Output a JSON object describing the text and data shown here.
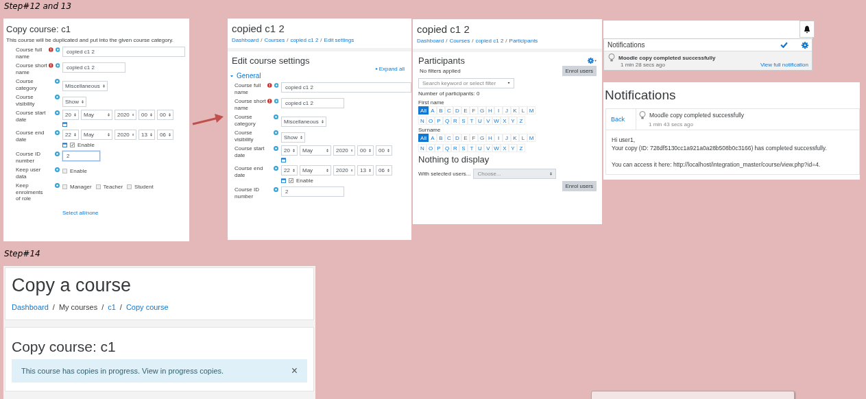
{
  "step_labels": [
    "Step#12 and 13",
    "Step#14"
  ],
  "copy_form": {
    "title": "Copy course: c1",
    "description": "This course will be duplicated and put into the given course category.",
    "fields": [
      {
        "label": "Course full name",
        "required": true,
        "help": true,
        "kind": "text",
        "value": "copied c1 2",
        "focused": false
      },
      {
        "label": "Course short name",
        "required": true,
        "help": true,
        "kind": "shorttext",
        "value": "copied c1 2",
        "focused": false
      },
      {
        "label": "Course category",
        "required": false,
        "help": true,
        "kind": "select",
        "value": "Miscellaneous"
      },
      {
        "label": "Course visibility",
        "required": false,
        "help": true,
        "kind": "select",
        "value": "Show"
      },
      {
        "label": "Course start date",
        "required": false,
        "help": true,
        "kind": "date",
        "parts": [
          "20",
          "May",
          "2020",
          "00",
          "00"
        ]
      },
      {
        "label": "Course end date",
        "required": false,
        "help": true,
        "kind": "date",
        "parts": [
          "22",
          "May",
          "2020",
          "13",
          "06"
        ],
        "enable": {
          "label": "Enable",
          "checked": true
        }
      },
      {
        "label": "Course ID number",
        "required": false,
        "help": true,
        "kind": "shorttext",
        "value": "2",
        "focused": true
      },
      {
        "label": "Keep user data",
        "required": false,
        "help": true,
        "kind": "checks",
        "options": [
          {
            "label": "Enable",
            "checked": false
          }
        ]
      },
      {
        "label": "Keep enrolments of role",
        "required": false,
        "help": true,
        "kind": "checks",
        "options": [
          {
            "label": "Manager",
            "checked": false
          },
          {
            "label": "Teacher",
            "checked": false
          },
          {
            "label": "Student",
            "checked": false
          }
        ]
      }
    ],
    "link": "Select all/none"
  },
  "edit_settings": {
    "course_title": "copied c1 2",
    "breadcrumbs": {
      "separator": "/",
      "items": [
        {
          "label": "Dashboard",
          "link": true
        },
        {
          "label": "Courses",
          "link": true
        },
        {
          "label": "copied c1 2",
          "link": true
        },
        {
          "label": "Edit settings",
          "link": true
        }
      ]
    },
    "heading": "Edit course settings",
    "expand_all": "Expand all",
    "section": {
      "label": "General",
      "expanded": true
    },
    "fields": [
      {
        "label": "Course full name",
        "required": true,
        "help": true,
        "kind": "text",
        "value": "copied c1 2",
        "focused": false
      },
      {
        "label": "Course short name",
        "required": true,
        "help": true,
        "kind": "shorttext",
        "value": "copied c1 2",
        "focused": false
      },
      {
        "label": "Course category",
        "required": false,
        "help": true,
        "kind": "select",
        "value": "Miscellaneous"
      },
      {
        "label": "Course visibility",
        "required": false,
        "help": true,
        "kind": "select",
        "value": "Show"
      },
      {
        "label": "Course start date",
        "required": false,
        "help": true,
        "kind": "date",
        "parts": [
          "20",
          "May",
          "2020",
          "00",
          "00"
        ]
      },
      {
        "label": "Course end date",
        "required": false,
        "help": true,
        "kind": "date",
        "parts": [
          "22",
          "May",
          "2020",
          "13",
          "06"
        ],
        "enable": {
          "label": "Enable",
          "checked": true
        }
      },
      {
        "label": "Course ID number",
        "required": false,
        "help": true,
        "kind": "shorttext",
        "value": "2",
        "focused": false
      }
    ]
  },
  "participants": {
    "course_title": "copied c1 2",
    "breadcrumbs": {
      "separator": "/",
      "items": [
        {
          "label": "Dashboard",
          "link": true
        },
        {
          "label": "Courses",
          "link": true
        },
        {
          "label": "copied c1 2",
          "link": true
        },
        {
          "label": "Participants",
          "link": true
        }
      ]
    },
    "heading": "Participants",
    "filters": "No filters applied",
    "enrol_button": "Enrol users",
    "search_placeholder": "Search keyword or select filter",
    "count": "Number of participants: 0",
    "initials": [
      {
        "label": "First name",
        "letters": [
          {
            "label": "All",
            "selected": true
          },
          {
            "label": "A",
            "selected": false
          },
          {
            "label": "B",
            "selected": false
          },
          {
            "label": "C",
            "selected": false
          },
          {
            "label": "D",
            "selected": false
          },
          {
            "label": "E",
            "selected": false
          },
          {
            "label": "F",
            "selected": false
          },
          {
            "label": "G",
            "selected": false
          },
          {
            "label": "H",
            "selected": false
          },
          {
            "label": "I",
            "selected": false
          },
          {
            "label": "J",
            "selected": false
          },
          {
            "label": "K",
            "selected": false
          },
          {
            "label": "L",
            "selected": false
          },
          {
            "label": "M",
            "selected": false
          },
          {
            "label": "N",
            "selected": false
          },
          {
            "label": "O",
            "selected": false
          },
          {
            "label": "P",
            "selected": false
          },
          {
            "label": "Q",
            "selected": false
          },
          {
            "label": "R",
            "selected": false
          },
          {
            "label": "S",
            "selected": false
          },
          {
            "label": "T",
            "selected": false
          },
          {
            "label": "U",
            "selected": false
          },
          {
            "label": "V",
            "selected": false
          },
          {
            "label": "W",
            "selected": false
          },
          {
            "label": "X",
            "selected": false
          },
          {
            "label": "Y",
            "selected": false
          },
          {
            "label": "Z",
            "selected": false
          }
        ]
      },
      {
        "label": "Surname",
        "letters": [
          {
            "label": "All",
            "selected": true
          },
          {
            "label": "A",
            "selected": false
          },
          {
            "label": "B",
            "selected": false
          },
          {
            "label": "C",
            "selected": false
          },
          {
            "label": "D",
            "selected": false
          },
          {
            "label": "E",
            "selected": false
          },
          {
            "label": "F",
            "selected": false
          },
          {
            "label": "G",
            "selected": false
          },
          {
            "label": "H",
            "selected": false
          },
          {
            "label": "I",
            "selected": false
          },
          {
            "label": "J",
            "selected": false
          },
          {
            "label": "K",
            "selected": false
          },
          {
            "label": "L",
            "selected": false
          },
          {
            "label": "M",
            "selected": false
          },
          {
            "label": "N",
            "selected": false
          },
          {
            "label": "O",
            "selected": false
          },
          {
            "label": "P",
            "selected": false
          },
          {
            "label": "Q",
            "selected": false
          },
          {
            "label": "R",
            "selected": false
          },
          {
            "label": "S",
            "selected": false
          },
          {
            "label": "T",
            "selected": false
          },
          {
            "label": "U",
            "selected": false
          },
          {
            "label": "V",
            "selected": false
          },
          {
            "label": "W",
            "selected": false
          },
          {
            "label": "X",
            "selected": false
          },
          {
            "label": "Y",
            "selected": false
          },
          {
            "label": "Z",
            "selected": false
          }
        ]
      }
    ],
    "empty": "Nothing to display",
    "bulk_label": "With selected users...",
    "bulk_placeholder": "Choose...",
    "enrol_button_bottom": "Enrol users"
  },
  "notification_popover": {
    "title": "Notifications",
    "item": {
      "title": "Moodle copy completed successfully",
      "time": "1 min 28 secs ago",
      "link": "View full notification"
    }
  },
  "notification_page": {
    "title": "Notifications",
    "back": "Back",
    "item": {
      "title": "Moodle copy completed successfully",
      "time": "1 min 43 secs ago"
    },
    "greeting": "Hi user1,",
    "body": "Your copy (ID: 728df5130cc1a921a0a28b508b0c3166) has completed successfully.",
    "access": "You can access it here: http://localhost/integration_master/course/view.php?id=4."
  },
  "copy_course_page": {
    "title": "Copy a course",
    "breadcrumbs": {
      "separator": "/",
      "items": [
        {
          "label": "Dashboard",
          "link": true
        },
        {
          "label": "My courses",
          "link": false
        },
        {
          "label": "c1",
          "link": true
        },
        {
          "label": "Copy course",
          "link": true
        }
      ]
    },
    "heading": "Copy course: c1",
    "alert": "This course has copies in progress. View in progress copies.",
    "close": "×"
  }
}
